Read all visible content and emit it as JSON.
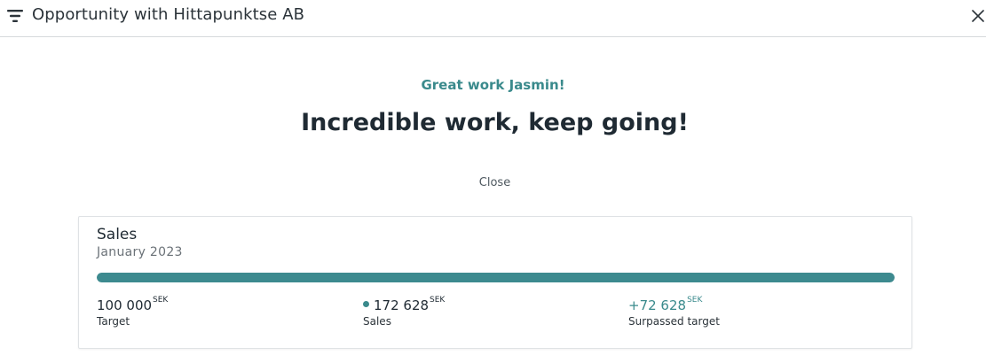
{
  "header": {
    "title": "Opportunity with Hittapunktse AB",
    "filter_icon": "filter-icon",
    "close_icon": "close-icon"
  },
  "celebration": {
    "greeting": "Great work Jasmin!",
    "headline": "Incredible work, keep going!",
    "close_label": "Close"
  },
  "sales_card": {
    "title": "Sales",
    "period": "January 2023",
    "progress_fraction": 1.0,
    "target": {
      "value": "100 000",
      "currency": "SEK",
      "label": "Target"
    },
    "sales": {
      "value": "172 628",
      "currency": "SEK",
      "label": "Sales"
    },
    "surplus": {
      "value": "+72 628",
      "currency": "SEK",
      "label": "Surpassed target"
    }
  },
  "colors": {
    "accent": "#3a8a8c",
    "progress_fill": "#3d8a8f",
    "text_dark": "#1f2a33",
    "divider": "#d6d9dc"
  }
}
